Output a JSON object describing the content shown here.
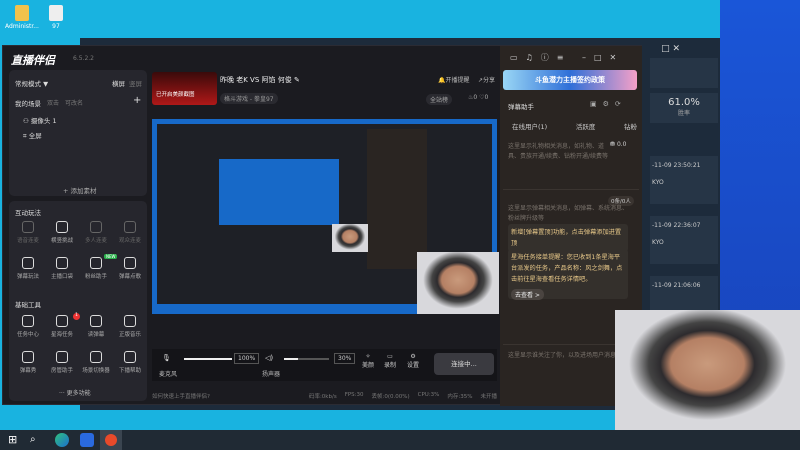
{
  "desktop": {
    "icons": [
      {
        "label": "Administr..."
      },
      {
        "label": "97"
      }
    ]
  },
  "game_window": {
    "win_rate": "61.0%",
    "win_rate_label": "胜率",
    "matches": [
      {
        "time": "-11-09 23:50:21",
        "name": "KYO"
      },
      {
        "time": "-11-09 22:36:07",
        "name": "KYO"
      },
      {
        "time": "-11-09 21:06:06",
        "name": ""
      }
    ]
  },
  "app": {
    "logo": "直播伴侣",
    "version": "6.5.2.2",
    "scene": {
      "mode": "常规模式 ▼",
      "landscape": "横屏",
      "portrait": "竖屏",
      "tabs": [
        "我的场景",
        "双击",
        "可改名"
      ],
      "sources": [
        "摄像头 1",
        "全屏"
      ],
      "add_source": "+ 添加素材"
    },
    "interactive": {
      "title": "互动玩法",
      "items": [
        "语音连麦",
        "横竖挑战",
        "多人连麦",
        "观众连麦",
        "弹幕玩法",
        "主播口袋",
        "粉丝助手",
        "弹幕点歌"
      ],
      "new_badge": "NEW"
    },
    "tools": {
      "title": "基础工具",
      "items": [
        "任务中心",
        "星海任务",
        "读弹幕",
        "正版音乐",
        "弹幕秀",
        "房管助手",
        "场景切换器",
        "下播帮助"
      ],
      "badge": "1",
      "more": "··· 更多功能"
    },
    "stream": {
      "title": "昨晚 老K VS 阿馅 何俊",
      "category": "格斗游戏 - 拳皇97",
      "thumb_text": "已开启美颜截图",
      "remind": "开播提醒",
      "share": "分享",
      "rank": "全站榜",
      "fire": "0",
      "likes": "0"
    },
    "controls": {
      "mic_label": "麦克风",
      "mic_volume": "100%",
      "mic_level": 100,
      "speaker_label": "扬声器",
      "speaker_volume": "30%",
      "speaker_level": 30,
      "beauty": "美颜",
      "record": "录制",
      "settings": "设置",
      "connect": "连接中..."
    },
    "status": {
      "tip": "如何快速上手直播伴侣?",
      "bitrate": "码率:0kb/s",
      "fps": "FPS:30",
      "drop": "丢帧:0(0.00%)",
      "cpu": "CPU:3%",
      "mem": "内存:35%",
      "live": "未开播"
    },
    "assistant": {
      "banner": "斗鱼潜力主播签约政策",
      "title": "弹幕助手",
      "tabs": [
        "在线用户(1)",
        "活跃度",
        "钻粉"
      ],
      "gift_count": "0.0",
      "gift_msg": "这里显示礼物相关消息，如礼物、道具、贵族开通/续费、钻粉开通/续费等",
      "danmu_count": "0条/0人",
      "danmu_msg": "这里显示弹幕相关消息，如弹幕、系统消息、粉丝牌升级等",
      "notice1": "新增[弹幕置顶]功能，点击弹幕添加进置顶",
      "notice2": "星海任务接单提醒：您已收到1条星海平台派发的任务，产品名称：风之剑舞，点击前往星海查看任务详情吧。",
      "go_view": "去查看 >",
      "follow_msg": "这里显示谁关注了你，以及进场用户消息"
    }
  }
}
